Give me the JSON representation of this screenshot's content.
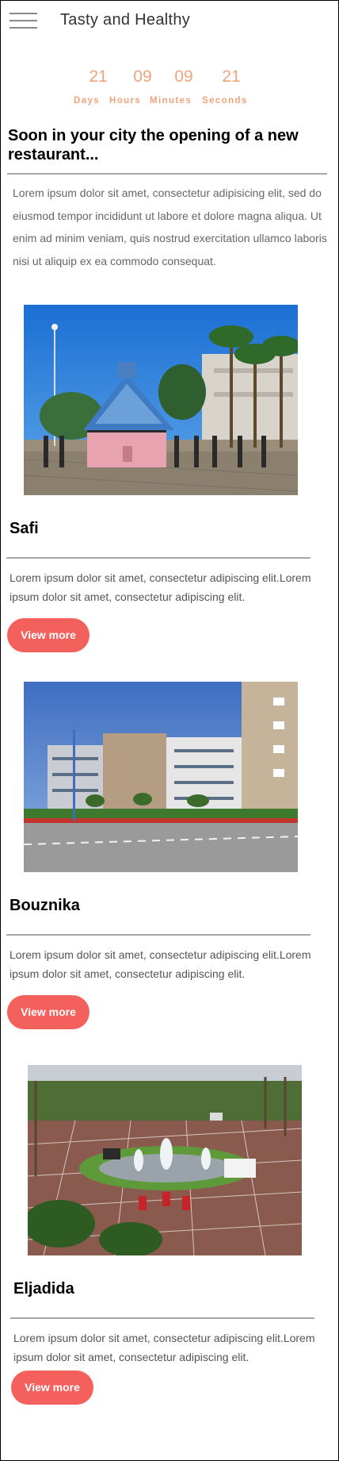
{
  "header": {
    "brand": "Tasty and Healthy",
    "menu_icon": "hamburger-menu-icon"
  },
  "countdown": {
    "days": "21",
    "hours": "09",
    "minutes": "09",
    "seconds": "21",
    "days_label": "Days",
    "hours_label": "Hours",
    "minutes_label": "Minutes",
    "seconds_label": "Seconds",
    "color": "#f0a47a"
  },
  "announcement": {
    "title": "Soon in your city the opening of a new restaurant...",
    "body": "Lorem ipsum dolor sit amet, consectetur adipisicing elit, sed do eiusmod tempor incididunt ut labore et dolore magna aliqua. Ut enim ad minim veniam, quis nostrud exercitation ullamco laboris nisi ut aliquip ex ea commodo consequat."
  },
  "cities": [
    {
      "name": "Safi",
      "description": "Lorem ipsum dolor sit amet, consectetur adipiscing elit.Lorem ipsum dolor sit amet, consectetur adipiscing elit.",
      "button": "View more"
    },
    {
      "name": "Bouznika",
      "description": "Lorem ipsum dolor sit amet, consectetur adipiscing elit.Lorem ipsum dolor sit amet, consectetur adipiscing elit.",
      "button": "View more"
    },
    {
      "name": "Eljadida",
      "description": "Lorem ipsum dolor sit amet, consectetur adipiscing elit.Lorem ipsum dolor sit amet, consectetur adipiscing elit.",
      "button": "View more"
    }
  ],
  "colors": {
    "accent_button": "#f4605c",
    "divider": "#a8a8a8"
  }
}
